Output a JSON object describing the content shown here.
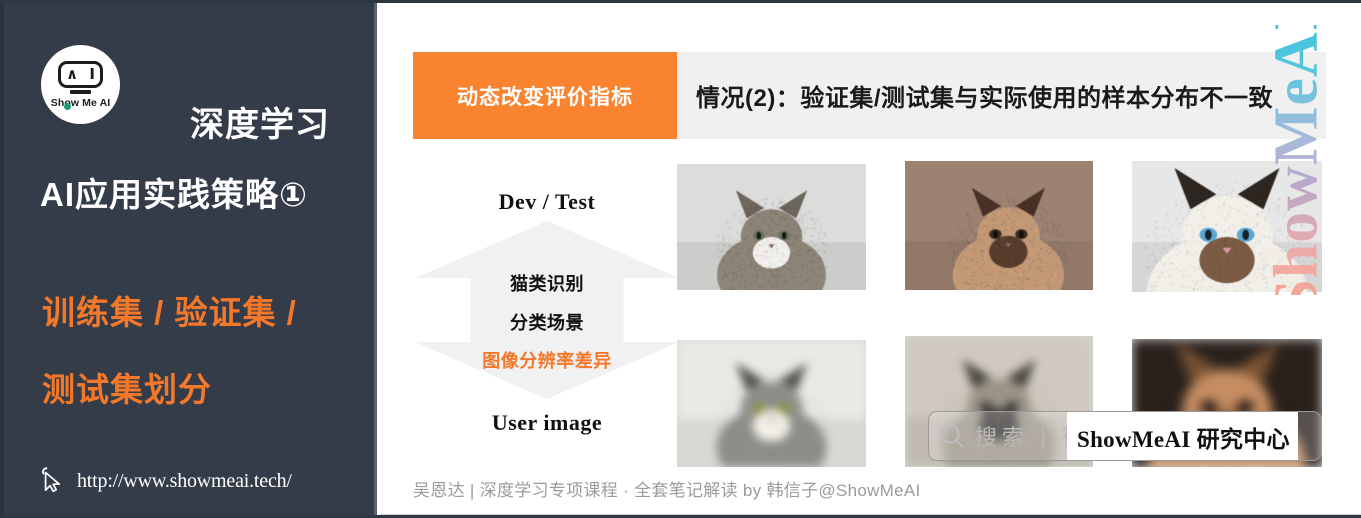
{
  "sidebar": {
    "logo": {
      "icon_name": "showmeai-robot-logo",
      "caret_glyph": "∧ I",
      "wordmark": "Show Me AI"
    },
    "title_line1": "深度学习",
    "title_line2": "AI应用实践策略①",
    "subtitle_line1": "训练集 / 验证集 /",
    "subtitle_line2": "测试集划分",
    "url": "http://www.showmeai.tech/",
    "cursor_icon": "mouse-pointer-icon",
    "bg_color": "#343c4a",
    "accent_color": "#f4782a"
  },
  "content": {
    "header": {
      "chip_label": "动态改变评价指标",
      "chip_color": "#f9832f",
      "band_color": "#f0f0f0",
      "title": "情况(2)：验证集/测试集与实际使用的样本分布不一致"
    },
    "diagram": {
      "top_label": "Dev / Test",
      "bottom_label": "User image",
      "middle_lines": [
        "猫类识别",
        "分类场景",
        "图像分辨率差异"
      ],
      "highlight_color": "#f4782a",
      "arrow_color": "#f1f1f1",
      "arrow_icon": "double-headed-vertical-arrow"
    },
    "images": {
      "row1_caption_ref": "Dev / Test",
      "row2_caption_ref": "User image",
      "row1": [
        {
          "alt": "tabby-cat-sitting-on-blanket",
          "quality": "sharp"
        },
        {
          "alt": "siamese-cat-lying-on-carpet",
          "quality": "sharp"
        },
        {
          "alt": "ragdoll-cat-blue-eyes-closeup",
          "quality": "sharp"
        }
      ],
      "row2": [
        {
          "alt": "blurry-grey-cat-face",
          "quality": "blurry"
        },
        {
          "alt": "blurry-tabby-cats-on-couch",
          "quality": "blurry"
        },
        {
          "alt": "blurry-fluffy-orange-cat",
          "quality": "blurry"
        }
      ]
    },
    "watermarks": {
      "vertical_text": "ShowMeAI",
      "search_icon": "magnifier-icon",
      "search_phrase": "搜索 | 微信",
      "brand_text": "ShowMeAI 研究中心"
    },
    "caption": "吴恩达 | 深度学习专项课程 · 全套笔记解读  by 韩信子@ShowMeAI"
  }
}
